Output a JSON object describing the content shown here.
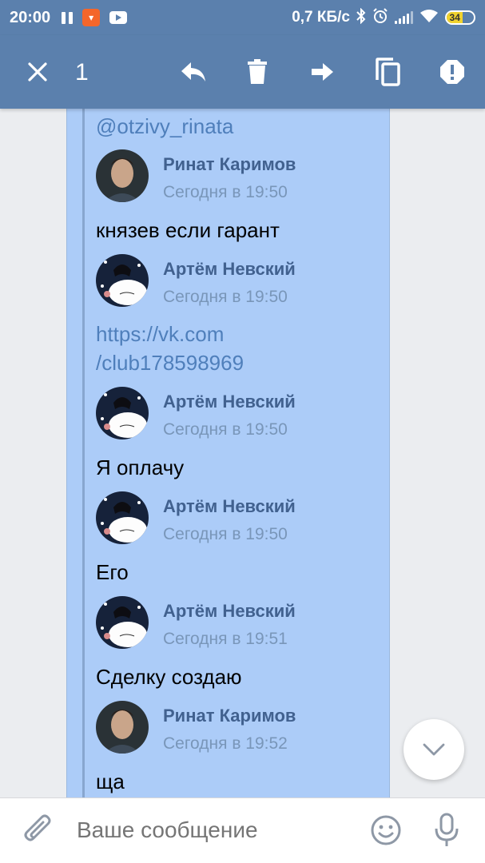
{
  "status_bar": {
    "time": "20:00",
    "network_speed": "0,7 КБ/с",
    "battery": "34",
    "battery_percent": 34,
    "icons": [
      "pause-icon",
      "app-notification-icon",
      "youtube-icon",
      "bluetooth-icon",
      "alarm-icon",
      "signal-icon",
      "wifi-icon",
      "battery-icon"
    ]
  },
  "action_bar": {
    "selected_count": "1",
    "icons": [
      "close-icon",
      "reply-icon",
      "delete-icon",
      "forward-icon",
      "copy-icon",
      "report-icon"
    ]
  },
  "forwarded": {
    "top_mention": "@otzivy_rinata",
    "messages": [
      {
        "author": "Ринат Каримов",
        "time": "Сегодня в 19:50",
        "text": "князев если гарант",
        "is_link": false,
        "avatar": "rinat"
      },
      {
        "author": "Артём Невский",
        "time": "Сегодня в 19:50",
        "text_lines": [
          "https://vk.com",
          "/club178598969"
        ],
        "is_link": true,
        "avatar": "artem"
      },
      {
        "author": "Артём Невский",
        "time": "Сегодня в 19:50",
        "text": "Я оплачу",
        "is_link": false,
        "avatar": "artem"
      },
      {
        "author": "Артём Невский",
        "time": "Сегодня в 19:50",
        "text": "Его",
        "is_link": false,
        "avatar": "artem"
      },
      {
        "author": "Артём Невский",
        "time": "Сегодня в 19:51",
        "text": "Сделку создаю",
        "is_link": false,
        "avatar": "artem"
      },
      {
        "author": "Ринат Каримов",
        "time": "Сегодня в 19:52",
        "text": "ща",
        "is_link": false,
        "avatar": "rinat"
      }
    ]
  },
  "composer": {
    "placeholder": "Ваше сообщение",
    "icons": [
      "attach-icon",
      "emoji-icon",
      "microphone-icon"
    ]
  },
  "colors": {
    "header": "#5b80ad",
    "bubble": "#acccf8",
    "link": "#4f7fbb",
    "author": "#41618f"
  }
}
